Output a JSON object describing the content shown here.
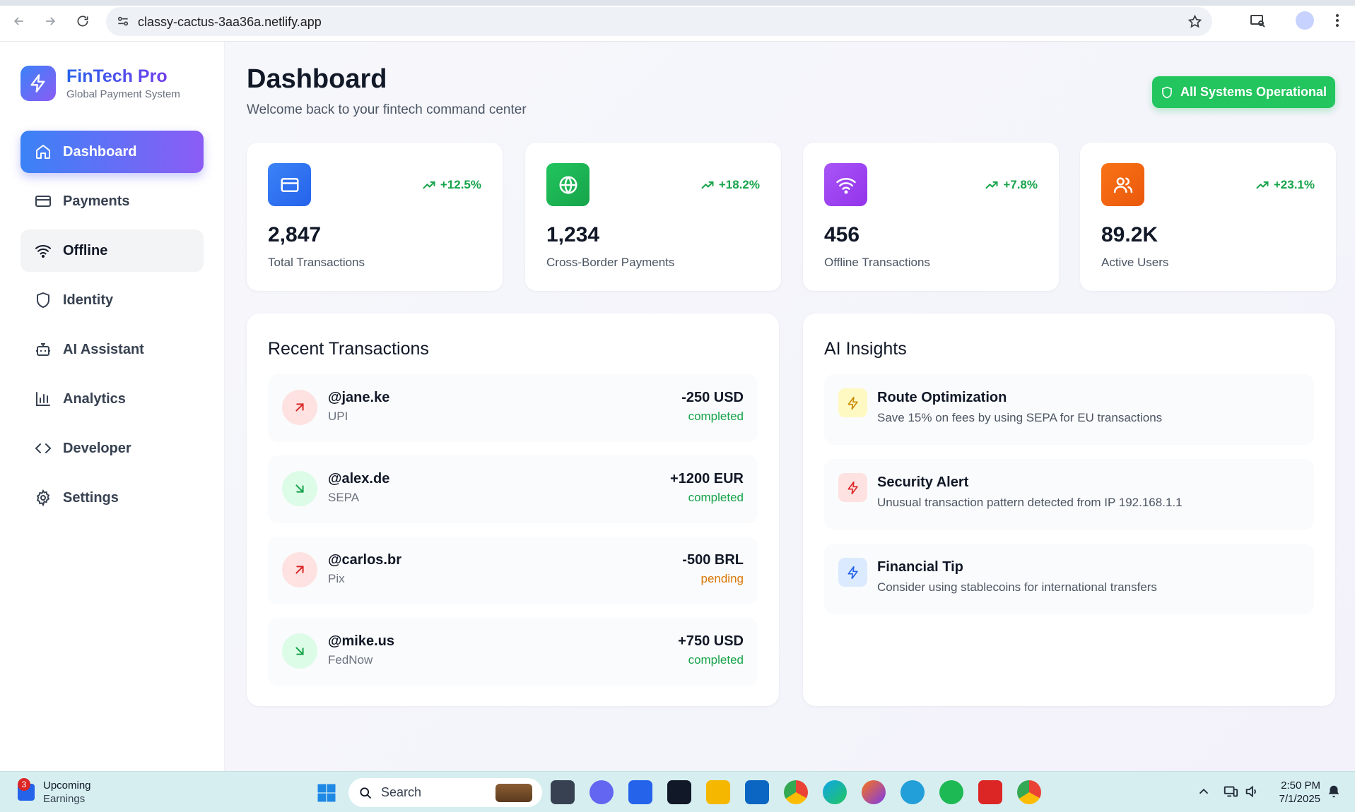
{
  "browser": {
    "url": "classy-cactus-3aa36a.netlify.app"
  },
  "brand": {
    "name": "FinTech Pro",
    "subtitle": "Global Payment System"
  },
  "nav": {
    "items": [
      {
        "label": "Dashboard",
        "icon": "home-icon",
        "state": "active"
      },
      {
        "label": "Payments",
        "icon": "credit-card-icon",
        "state": "normal"
      },
      {
        "label": "Offline",
        "icon": "wifi-icon",
        "state": "hover"
      },
      {
        "label": "Identity",
        "icon": "shield-icon",
        "state": "normal"
      },
      {
        "label": "AI Assistant",
        "icon": "bot-icon",
        "state": "normal"
      },
      {
        "label": "Analytics",
        "icon": "bar-chart-icon",
        "state": "normal"
      },
      {
        "label": "Developer",
        "icon": "code-icon",
        "state": "normal"
      },
      {
        "label": "Settings",
        "icon": "gear-icon",
        "state": "normal"
      }
    ]
  },
  "header": {
    "title": "Dashboard",
    "subtitle": "Welcome back to your fintech command center",
    "status": "All Systems Operational"
  },
  "stats": [
    {
      "value": "2,847",
      "label": "Total Transactions",
      "trend": "+12.5%",
      "icon": "credit-card-icon",
      "color": "#3b82f6"
    },
    {
      "value": "1,234",
      "label": "Cross-Border Payments",
      "trend": "+18.2%",
      "icon": "globe-icon",
      "color": "#22c55e"
    },
    {
      "value": "456",
      "label": "Offline Transactions",
      "trend": "+7.8%",
      "icon": "wifi-icon",
      "color": "#a855f7"
    },
    {
      "value": "89.2K",
      "label": "Active Users",
      "trend": "+23.1%",
      "icon": "users-icon",
      "color": "#f97316"
    }
  ],
  "recent_transactions": {
    "title": "Recent Transactions",
    "items": [
      {
        "user": "@jane.ke",
        "method": "UPI",
        "amount": "-250 USD",
        "status": "completed",
        "direction": "out"
      },
      {
        "user": "@alex.de",
        "method": "SEPA",
        "amount": "+1200 EUR",
        "status": "completed",
        "direction": "in"
      },
      {
        "user": "@carlos.br",
        "method": "Pix",
        "amount": "-500 BRL",
        "status": "pending",
        "direction": "out"
      },
      {
        "user": "@mike.us",
        "method": "FedNow",
        "amount": "+750 USD",
        "status": "completed",
        "direction": "in"
      }
    ]
  },
  "ai_insights": {
    "title": "AI Insights",
    "items": [
      {
        "title": "Route Optimization",
        "description": "Save 15% on fees by using SEPA for EU transactions",
        "icon": "zap-icon",
        "color": "#ca8a04",
        "bg": "#fef9c3"
      },
      {
        "title": "Security Alert",
        "description": "Unusual transaction pattern detected from IP 192.168.1.1",
        "icon": "zap-icon",
        "color": "#dc2626",
        "bg": "#fee2e2"
      },
      {
        "title": "Financial Tip",
        "description": "Consider using stablecoins for international transfers",
        "icon": "zap-icon",
        "color": "#2563eb",
        "bg": "#dbeafe"
      }
    ]
  },
  "taskbar": {
    "weather_title": "Upcoming",
    "weather_sub": "Earnings",
    "weather_badge": "3",
    "search_placeholder": "Search",
    "time": "2:50 PM",
    "date": "7/1/2025"
  },
  "colors": {
    "accent_start": "#3b82f6",
    "accent_end": "#8b5cf6",
    "success": "#22c55e",
    "pending": "#d97706"
  }
}
